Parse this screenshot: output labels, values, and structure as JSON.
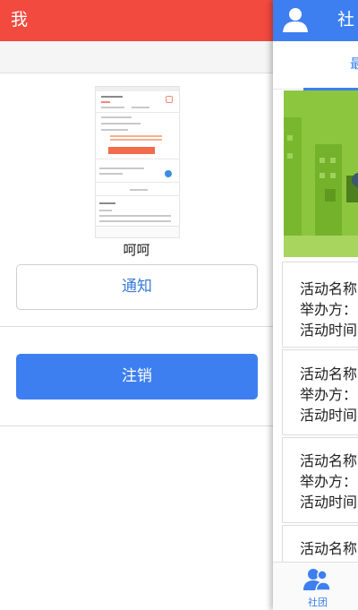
{
  "me_screen": {
    "title": "我",
    "profile_name": "呵呵",
    "notify_button": "通知",
    "logout_button": "注销"
  },
  "club_screen": {
    "title": "社",
    "tab_label": "最",
    "activities": [
      {
        "name_label": "活动名称",
        "organizer_label": "举办方：",
        "time_label": "活动时间"
      },
      {
        "name_label": "活动名称",
        "organizer_label": "举办方：",
        "time_label": "活动时间"
      },
      {
        "name_label": "活动名称",
        "organizer_label": "举办方：",
        "time_label": "活动时间"
      },
      {
        "name_label": "活动名称"
      }
    ],
    "bottom_nav": {
      "label": "社团",
      "icon": "club-icon"
    }
  },
  "colors": {
    "me_header": "#f34a3f",
    "club_header": "#3d7ff0",
    "logout_button": "#3d7ff0",
    "notify_text": "#3a7ad8",
    "banner_green": "#8cc63f"
  }
}
